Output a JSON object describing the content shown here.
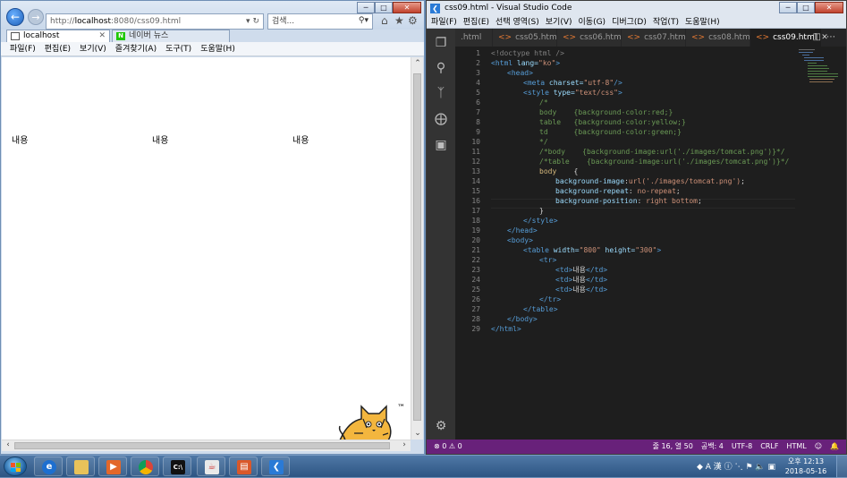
{
  "ie": {
    "address": "http://localhost:8080/css09.html",
    "address_prefix": "http://",
    "address_host": "localhost",
    "address_rest": ":8080/css09.html",
    "search_placeholder": "검색...",
    "tabs": [
      {
        "label": "localhost"
      },
      {
        "label": "네이버 뉴스",
        "favicon": "N"
      }
    ],
    "menu": [
      "파일(F)",
      "편집(E)",
      "보기(V)",
      "즐겨찾기(A)",
      "도구(T)",
      "도움말(H)"
    ],
    "content": {
      "cells": [
        "내용",
        "내용",
        "내용"
      ],
      "tm_mark": "™"
    }
  },
  "vscode": {
    "title": "css09.html - Visual Studio Code",
    "menu": [
      "파일(F)",
      "편집(E)",
      "선택 영역(S)",
      "보기(V)",
      "이동(G)",
      "디버그(D)",
      "작업(T)",
      "도움말(H)"
    ],
    "tabs": [
      {
        "label": ".html"
      },
      {
        "label": "css05.html"
      },
      {
        "label": "css06.html"
      },
      {
        "label": "css07.html"
      },
      {
        "label": "css08.html"
      },
      {
        "label": "css09.html",
        "active": true
      }
    ],
    "line_numbers": [
      "1",
      "2",
      "3",
      "4",
      "5",
      "6",
      "7",
      "8",
      "9",
      "10",
      "11",
      "12",
      "13",
      "14",
      "15",
      "16",
      "17",
      "18",
      "19",
      "20",
      "21",
      "22",
      "23",
      "24",
      "25",
      "26",
      "27",
      "28",
      "29"
    ],
    "code": {
      "l1": "<!doctype html />",
      "l2_tag": "<html",
      "l2_attr": " lang=",
      "l2_val": "\"ko\"",
      "l2_end": ">",
      "l3": "<head>",
      "l4_tag": "<meta",
      "l4_attr": " charset=",
      "l4_val": "\"utf-8\"",
      "l4_end": "/>",
      "l5_tag": "<style",
      "l5_attr": " type=",
      "l5_val": "\"text/css\"",
      "l5_end": ">",
      "l6": "/*",
      "l7": "body    {background-color:red;}",
      "l8": "table   {background-color:yellow;}",
      "l9": "td      {background-color:green;}",
      "l10": "*/",
      "l11": "/*body    {background-image:url('./images/tomcat.png')}*/",
      "l12": "/*table    {background-image:url('./images/tomcat.png')}*/",
      "l13_sel": "body",
      "l13_brace": "    {",
      "l14_prop": "background-image",
      "l14_colon": ":",
      "l14_val": "url('./images/tomcat.png')",
      "l14_end": ";",
      "l15_prop": "background-repeat",
      "l15_colon": ": ",
      "l15_val": "no-repeat",
      "l15_end": ";",
      "l16_prop": "background-position",
      "l16_colon": ": ",
      "l16_val": "right bottom",
      "l16_end": ";",
      "l17": "}",
      "l18": "</style>",
      "l19": "</head>",
      "l20": "<body>",
      "l21_tag": "<table",
      "l21_attr1": " width=",
      "l21_val1": "\"800\"",
      "l21_attr2": " height=",
      "l21_val2": "\"300\"",
      "l21_end": ">",
      "l22": "<tr>",
      "td_open": "<td>",
      "td_text": "내용",
      "td_close": "</td>",
      "l26": "</tr>",
      "l27": "</table>",
      "l28": "</body>",
      "l29": "</html>"
    },
    "status": {
      "problems": "⊗ 0 ⚠ 0",
      "position": "줄 16, 열 50",
      "spaces": "공백: 4",
      "encoding": "UTF-8",
      "eol": "CRLF",
      "language": "HTML"
    }
  },
  "taskbar": {
    "ime": "A 漢",
    "time": "오후 12:13",
    "date": "2018-05-16"
  }
}
